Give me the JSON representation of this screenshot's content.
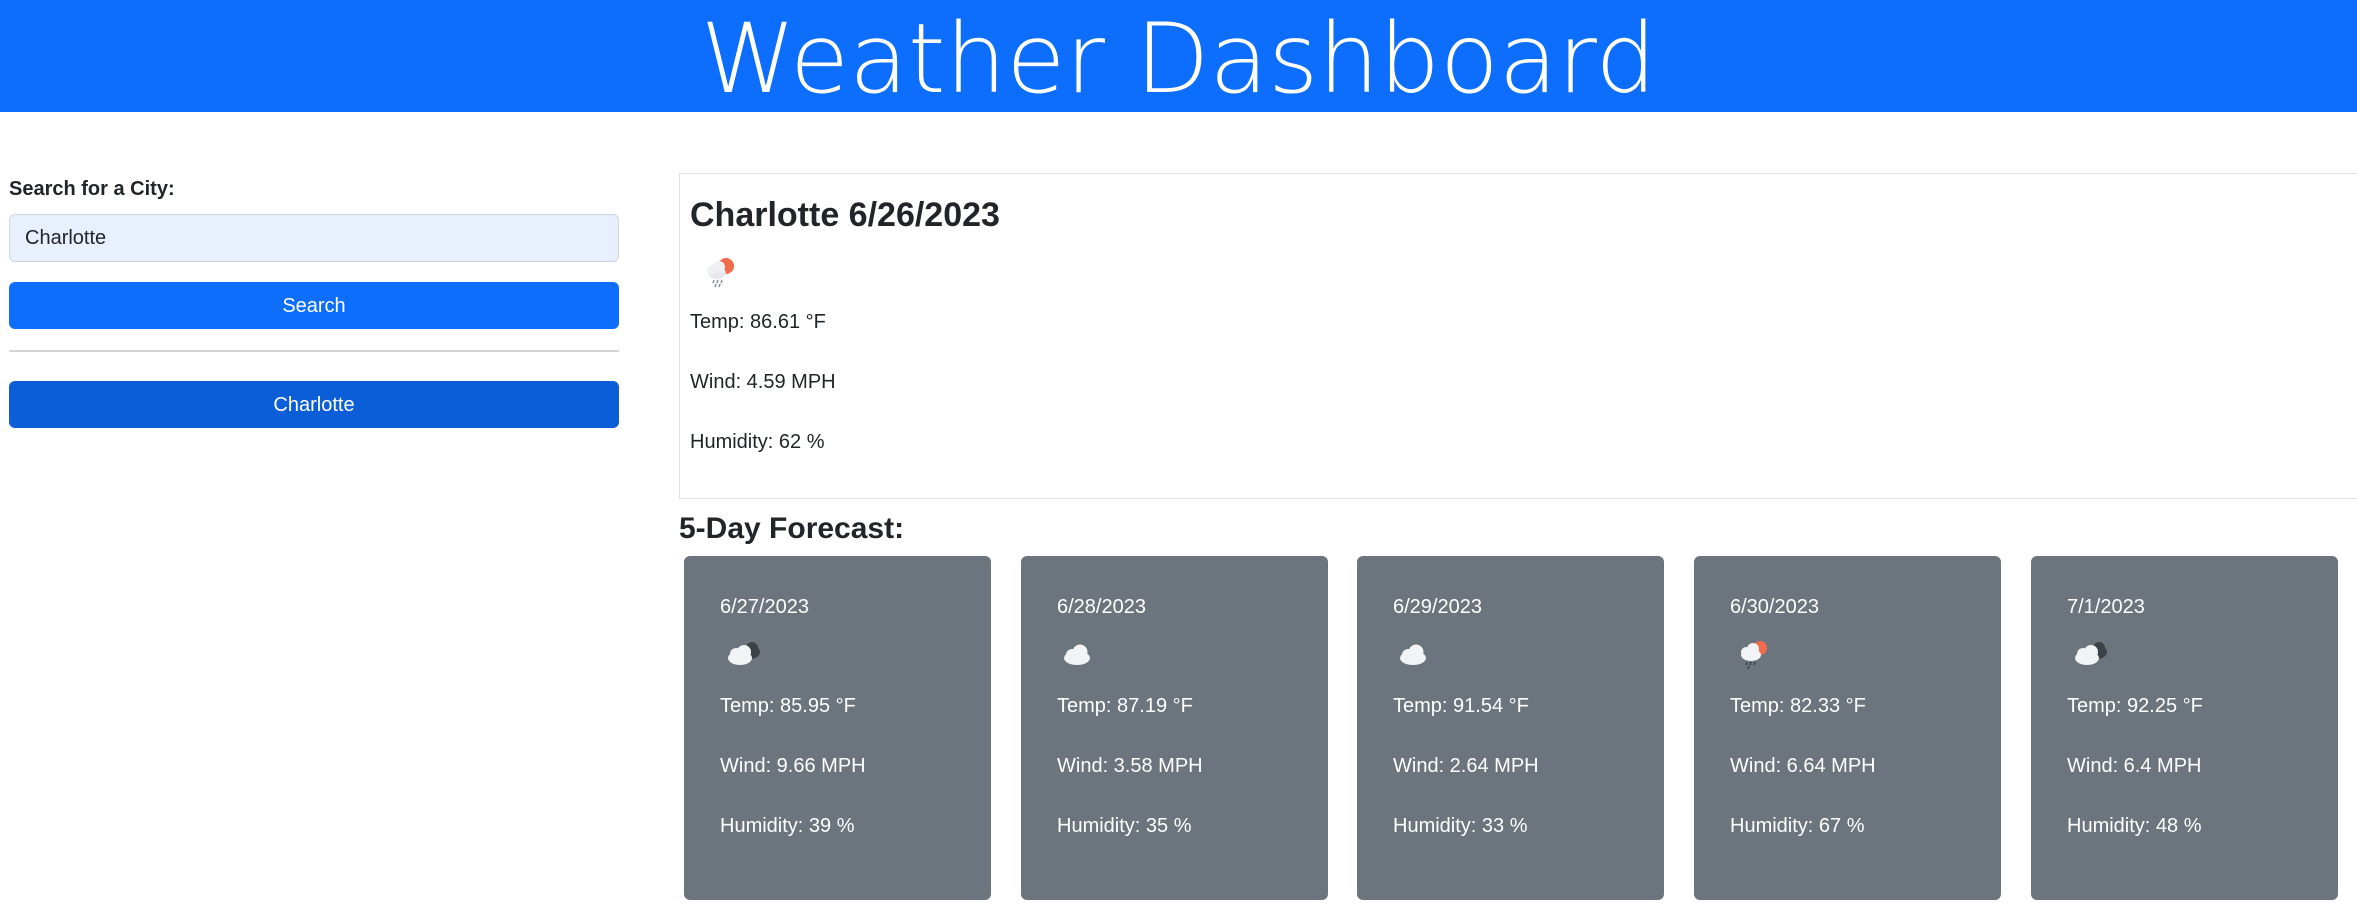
{
  "header": {
    "title": "Weather Dashboard"
  },
  "sidebar": {
    "search_label": "Search for a City:",
    "search_value": "Charlotte",
    "search_button": "Search",
    "history": [
      "Charlotte"
    ]
  },
  "current": {
    "heading": "Charlotte 6/26/2023",
    "icon": "sun-behind-rain-cloud-icon",
    "temp": "Temp: 86.61 °F",
    "wind": "Wind: 4.59 MPH",
    "humidity": "Humidity: 62 %"
  },
  "forecast": {
    "title": "5-Day Forecast:",
    "days": [
      {
        "date": "6/27/2023",
        "icon": "broken-clouds-icon",
        "temp": "Temp: 85.95 °F",
        "wind": "Wind: 9.66 MPH",
        "humidity": "Humidity: 39 %"
      },
      {
        "date": "6/28/2023",
        "icon": "cloud-icon",
        "temp": "Temp: 87.19 °F",
        "wind": "Wind: 3.58 MPH",
        "humidity": "Humidity: 35 %"
      },
      {
        "date": "6/29/2023",
        "icon": "cloud-icon",
        "temp": "Temp: 91.54 °F",
        "wind": "Wind: 2.64 MPH",
        "humidity": "Humidity: 33 %"
      },
      {
        "date": "6/30/2023",
        "icon": "sun-behind-rain-cloud-icon",
        "temp": "Temp: 82.33 °F",
        "wind": "Wind: 6.64 MPH",
        "humidity": "Humidity: 67 %"
      },
      {
        "date": "7/1/2023",
        "icon": "broken-clouds-icon",
        "temp": "Temp: 92.25 °F",
        "wind": "Wind: 6.4 MPH",
        "humidity": "Humidity: 48 %"
      }
    ]
  },
  "colors": {
    "primary": "#0d6efd",
    "history_button": "#0b5ed7",
    "card_bg": "#6c757d",
    "sun": "#f26b4a"
  }
}
